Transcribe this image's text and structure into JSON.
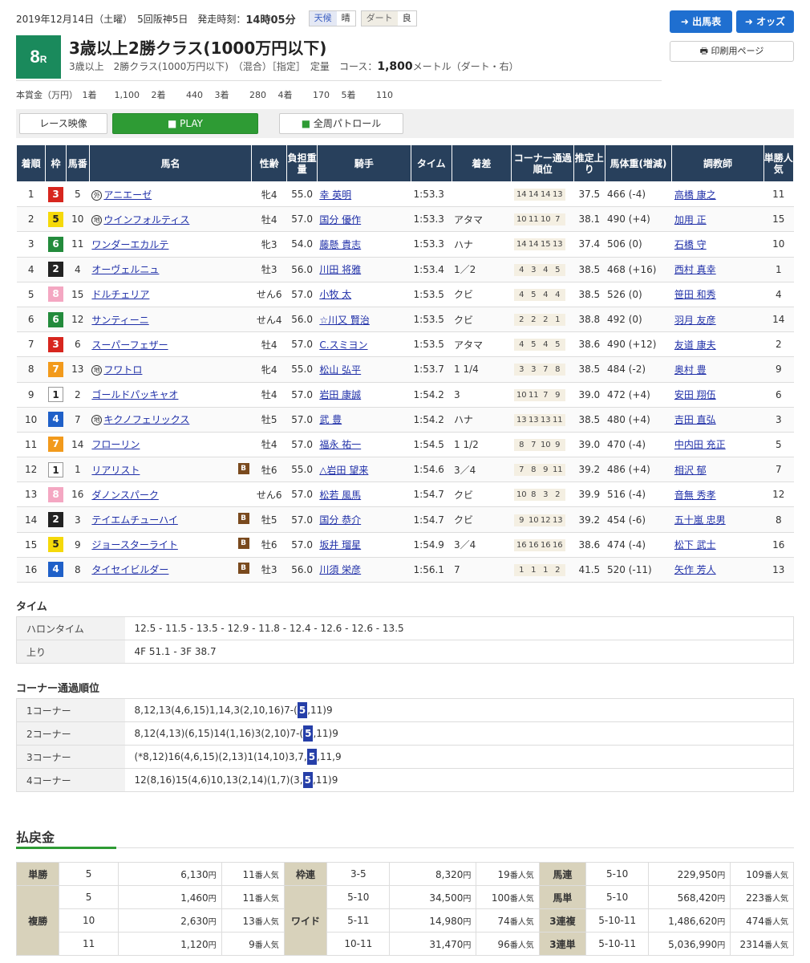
{
  "header": {
    "date": "2019年12月14日（土曜）",
    "meeting": "5回阪神5日",
    "start_label": "発走時刻：",
    "start_time": "14時05分",
    "weather_label": "天候",
    "weather": "晴",
    "track_label": "ダート",
    "track_cond": "良",
    "race_no": "8",
    "race_suffix": "R",
    "title": "3歳以上2勝クラス(1000万円以下)",
    "sub": "3歳以上　2勝クラス(1000万円以下)　（混合）［指定］　定量",
    "course_label": "コース：",
    "course_dist": "1,800",
    "course_unit": "メートル（ダート・右）",
    "prize": "本賞金（万円）　1着　　1,100　 2着　　 440　 3着　　 280　 4着　　 170　 5着　　 110",
    "btn_card": "出馬表",
    "btn_odds": "オッズ",
    "btn_print": "印刷用ページ"
  },
  "video": {
    "race_video": "レース映像",
    "play": "PLAY",
    "patrol": "全周パトロール"
  },
  "columns": [
    "着順",
    "枠",
    "馬番",
    "馬名",
    "性齢",
    "負担重量",
    "騎手",
    "タイム",
    "着差",
    "コーナー通過順位",
    "推定上り",
    "馬体重(増減)",
    "調教師",
    "単勝人気"
  ],
  "rows": [
    {
      "pos": "1",
      "waku": "3",
      "num": "5",
      "mark": "外",
      "name": "アニエーゼ",
      "blinker": "",
      "sex": "牝4",
      "wt": "55.0",
      "jockey": "幸 英明",
      "time": "1:53.3",
      "margin": "",
      "corners": [
        "14",
        "14",
        "14",
        "13"
      ],
      "agari": "37.5",
      "body": "466 (-4)",
      "trainer": "高橋 康之",
      "pop": "11"
    },
    {
      "pos": "2",
      "waku": "5",
      "num": "10",
      "mark": "地",
      "name": "ウインフォルティス",
      "blinker": "",
      "sex": "牡4",
      "wt": "57.0",
      "jockey": "国分 優作",
      "time": "1:53.3",
      "margin": "アタマ",
      "corners": [
        "10",
        "11",
        "10",
        "7"
      ],
      "agari": "38.1",
      "body": "490 (+4)",
      "trainer": "加用 正",
      "pop": "15"
    },
    {
      "pos": "3",
      "waku": "6",
      "num": "11",
      "mark": "",
      "name": "ワンダーエカルテ",
      "blinker": "",
      "sex": "牝3",
      "wt": "54.0",
      "jockey": "藤懸 貴志",
      "time": "1:53.3",
      "margin": "ハナ",
      "corners": [
        "14",
        "14",
        "15",
        "13"
      ],
      "agari": "37.4",
      "body": "506 (0)",
      "trainer": "石橋 守",
      "pop": "10"
    },
    {
      "pos": "4",
      "waku": "2",
      "num": "4",
      "mark": "",
      "name": "オーヴェルニュ",
      "blinker": "",
      "sex": "牡3",
      "wt": "56.0",
      "jockey": "川田 将雅",
      "time": "1:53.4",
      "margin": "1／2",
      "corners": [
        "4",
        "3",
        "4",
        "5"
      ],
      "agari": "38.5",
      "body": "468 (+16)",
      "trainer": "西村 真幸",
      "pop": "1"
    },
    {
      "pos": "5",
      "waku": "8",
      "num": "15",
      "mark": "",
      "name": "ドルチェリア",
      "blinker": "",
      "sex": "せん6",
      "wt": "57.0",
      "jockey": "小牧 太",
      "time": "1:53.5",
      "margin": "クビ",
      "corners": [
        "4",
        "5",
        "4",
        "4"
      ],
      "agari": "38.5",
      "body": "526 (0)",
      "trainer": "笹田 和秀",
      "pop": "4"
    },
    {
      "pos": "6",
      "waku": "6",
      "num": "12",
      "mark": "",
      "name": "サンティーニ",
      "blinker": "",
      "sex": "せん4",
      "wt": "56.0",
      "jockey": "☆川又 賢治",
      "time": "1:53.5",
      "margin": "クビ",
      "corners": [
        "2",
        "2",
        "2",
        "1"
      ],
      "agari": "38.8",
      "body": "492 (0)",
      "trainer": "羽月 友彦",
      "pop": "14"
    },
    {
      "pos": "7",
      "waku": "3",
      "num": "6",
      "mark": "",
      "name": "スーパーフェザー",
      "blinker": "",
      "sex": "牡4",
      "wt": "57.0",
      "jockey": "C.スミヨン",
      "time": "1:53.5",
      "margin": "アタマ",
      "corners": [
        "4",
        "5",
        "4",
        "5"
      ],
      "agari": "38.6",
      "body": "490 (+12)",
      "trainer": "友道 康夫",
      "pop": "2"
    },
    {
      "pos": "8",
      "waku": "7",
      "num": "13",
      "mark": "地",
      "name": "フワトロ",
      "blinker": "",
      "sex": "牝4",
      "wt": "55.0",
      "jockey": "松山 弘平",
      "time": "1:53.7",
      "margin": "1 1/4",
      "corners": [
        "3",
        "3",
        "7",
        "8"
      ],
      "agari": "38.5",
      "body": "484 (-2)",
      "trainer": "奥村 豊",
      "pop": "9"
    },
    {
      "pos": "9",
      "waku": "1",
      "num": "2",
      "mark": "",
      "name": "ゴールドパッキャオ",
      "blinker": "",
      "sex": "牡4",
      "wt": "57.0",
      "jockey": "岩田 康誠",
      "time": "1:54.2",
      "margin": "3",
      "corners": [
        "10",
        "11",
        "7",
        "9"
      ],
      "agari": "39.0",
      "body": "472 (+4)",
      "trainer": "安田 翔伍",
      "pop": "6"
    },
    {
      "pos": "10",
      "waku": "4",
      "num": "7",
      "mark": "地",
      "name": "キクノフェリックス",
      "blinker": "",
      "sex": "牡5",
      "wt": "57.0",
      "jockey": "武 豊",
      "time": "1:54.2",
      "margin": "ハナ",
      "corners": [
        "13",
        "13",
        "13",
        "11"
      ],
      "agari": "38.5",
      "body": "480 (+4)",
      "trainer": "吉田 直弘",
      "pop": "3"
    },
    {
      "pos": "11",
      "waku": "7",
      "num": "14",
      "mark": "",
      "name": "フローリン",
      "blinker": "",
      "sex": "牡4",
      "wt": "57.0",
      "jockey": "福永 祐一",
      "time": "1:54.5",
      "margin": "1 1/2",
      "corners": [
        "8",
        "7",
        "10",
        "9"
      ],
      "agari": "39.0",
      "body": "470 (-4)",
      "trainer": "中内田 充正",
      "pop": "5"
    },
    {
      "pos": "12",
      "waku": "1",
      "num": "1",
      "mark": "",
      "name": "リアリスト",
      "blinker": "B",
      "sex": "牡6",
      "wt": "55.0",
      "jockey": "△岩田 望来",
      "time": "1:54.6",
      "margin": "3／4",
      "corners": [
        "7",
        "8",
        "9",
        "11"
      ],
      "agari": "39.2",
      "body": "486 (+4)",
      "trainer": "相沢 郁",
      "pop": "7"
    },
    {
      "pos": "13",
      "waku": "8",
      "num": "16",
      "mark": "",
      "name": "ダノンスパーク",
      "blinker": "",
      "sex": "せん6",
      "wt": "57.0",
      "jockey": "松若 風馬",
      "time": "1:54.7",
      "margin": "クビ",
      "corners": [
        "10",
        "8",
        "3",
        "2"
      ],
      "agari": "39.9",
      "body": "516 (-4)",
      "trainer": "音無 秀孝",
      "pop": "12"
    },
    {
      "pos": "14",
      "waku": "2",
      "num": "3",
      "mark": "",
      "name": "テイエムチューハイ",
      "blinker": "B",
      "sex": "牡5",
      "wt": "57.0",
      "jockey": "国分 恭介",
      "time": "1:54.7",
      "margin": "クビ",
      "corners": [
        "9",
        "10",
        "12",
        "13"
      ],
      "agari": "39.2",
      "body": "454 (-6)",
      "trainer": "五十嵐 忠男",
      "pop": "8"
    },
    {
      "pos": "15",
      "waku": "5",
      "num": "9",
      "mark": "",
      "name": "ジョースターライト",
      "blinker": "B",
      "sex": "牡6",
      "wt": "57.0",
      "jockey": "坂井 瑠星",
      "time": "1:54.9",
      "margin": "3／4",
      "corners": [
        "16",
        "16",
        "16",
        "16"
      ],
      "agari": "38.6",
      "body": "474 (-4)",
      "trainer": "松下 武士",
      "pop": "16"
    },
    {
      "pos": "16",
      "waku": "4",
      "num": "8",
      "mark": "",
      "name": "タイセイビルダー",
      "blinker": "B",
      "sex": "牡3",
      "wt": "56.0",
      "jockey": "川須 栄彦",
      "time": "1:56.1",
      "margin": "7",
      "corners": [
        "1",
        "1",
        "1",
        "2"
      ],
      "agari": "41.5",
      "body": "520 (-11)",
      "trainer": "矢作 芳人",
      "pop": "13"
    }
  ],
  "waku_colors": {
    "1": "#ffffff",
    "2": "#222222",
    "3": "#d7261e",
    "4": "#1f60c8",
    "5": "#f5d90a",
    "6": "#238b3c",
    "7": "#f29a1c",
    "8": "#f4a7c2"
  },
  "time_section": {
    "title": "タイム",
    "furlong_label": "ハロンタイム",
    "furlong": "12.5 - 11.5 - 13.5 - 12.9 - 11.8 - 12.4 - 12.6 - 12.6 - 13.5",
    "agari_label": "上り",
    "agari": "4F 51.1 - 3F 38.7"
  },
  "corner_section": {
    "title": "コーナー通過順位",
    "rows": [
      {
        "label": "1コーナー",
        "pre": "8,12,13(4,6,15)1,14,3(2,10,16)7-(",
        "hi": "5",
        "post": ",11)9"
      },
      {
        "label": "2コーナー",
        "pre": "8,12(4,13)(6,15)14(1,16)3(2,10)7-(",
        "hi": "5",
        "post": ",11)9"
      },
      {
        "label": "3コーナー",
        "pre": "(*8,12)16(4,6,15)(2,13)1(14,10)3,7,",
        "hi": "5",
        "post": ",11,9"
      },
      {
        "label": "4コーナー",
        "pre": "12(8,16)15(4,6)10,13(2,14)(1,7)(3,",
        "hi": "5",
        "post": ",11)9"
      }
    ]
  },
  "payout": {
    "title": "払戻金",
    "tansho": {
      "label": "単勝",
      "num": "5",
      "yen": "6,130",
      "pop": "11"
    },
    "fukusho": {
      "label": "複勝",
      "rows": [
        {
          "num": "5",
          "yen": "1,460",
          "pop": "11"
        },
        {
          "num": "10",
          "yen": "2,630",
          "pop": "13"
        },
        {
          "num": "11",
          "yen": "1,120",
          "pop": "9"
        }
      ]
    },
    "wakuren": {
      "label": "枠連",
      "num": "3-5",
      "yen": "8,320",
      "pop": "19"
    },
    "wide": {
      "label": "ワイド",
      "rows": [
        {
          "num": "5-10",
          "yen": "34,500",
          "pop": "100"
        },
        {
          "num": "5-11",
          "yen": "14,980",
          "pop": "74"
        },
        {
          "num": "10-11",
          "yen": "31,470",
          "pop": "96"
        }
      ]
    },
    "umaren": {
      "label": "馬連",
      "num": "5-10",
      "yen": "229,950",
      "pop": "109"
    },
    "umatan": {
      "label": "馬単",
      "num": "5-10",
      "yen": "568,420",
      "pop": "223"
    },
    "sanrenpuku": {
      "label": "3連複",
      "num": "5-10-11",
      "yen": "1,486,620",
      "pop": "474"
    },
    "sanrentan": {
      "label": "3連単",
      "num": "5-10-11",
      "yen": "5,036,990",
      "pop": "2314"
    },
    "yen_unit": "円",
    "pop_unit": "番人気"
  }
}
